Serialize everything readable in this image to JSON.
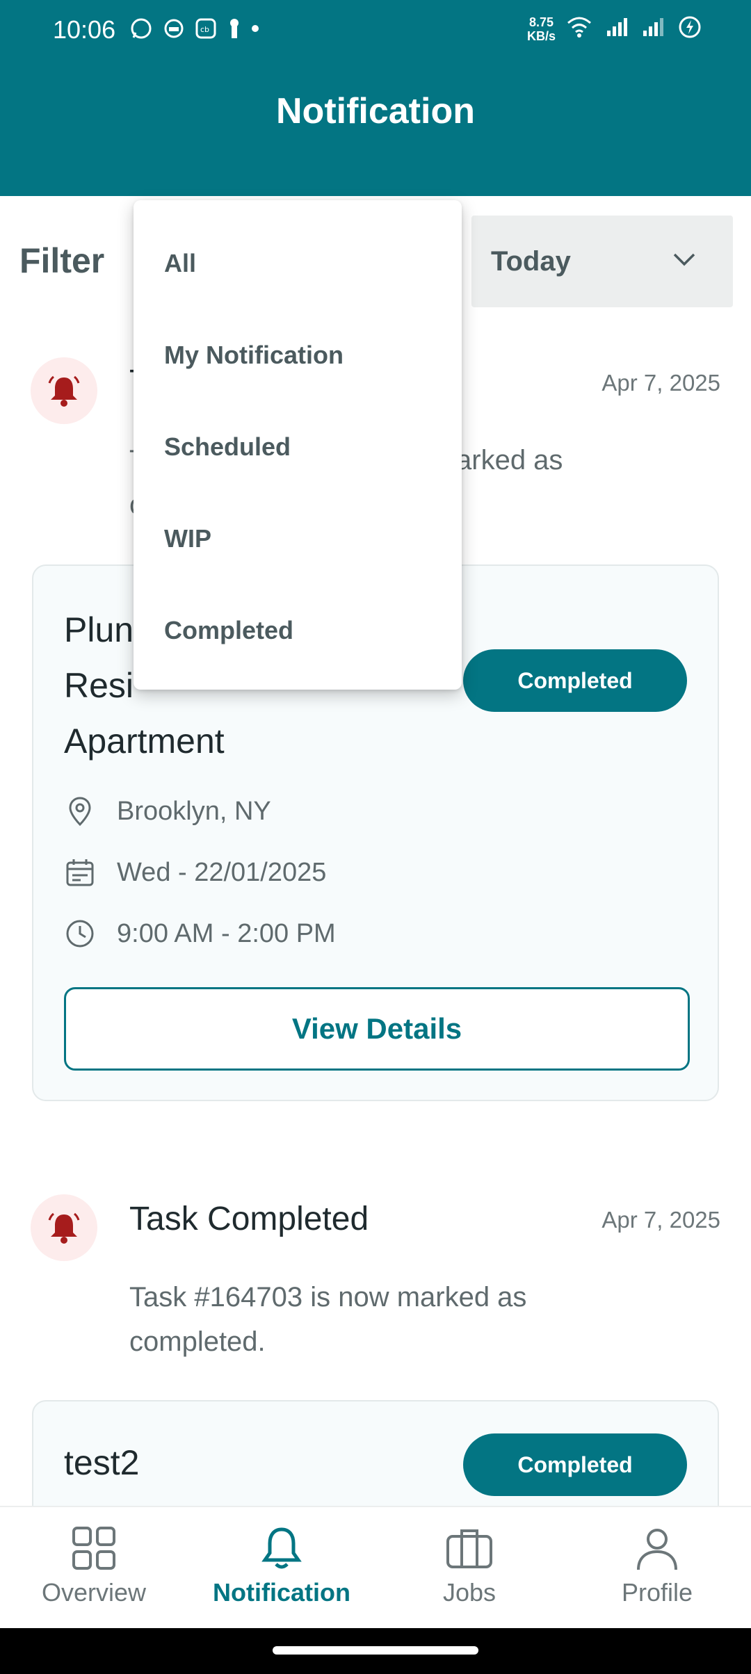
{
  "status_bar": {
    "time": "10:06",
    "net_speed_value": "8.75",
    "net_speed_unit": "KB/s"
  },
  "app_bar": {
    "title": "Notification"
  },
  "filter": {
    "label": "Filter",
    "date_range": "Today",
    "menu_items": [
      "All",
      "My Notification",
      "Scheduled",
      "WIP",
      "Completed"
    ]
  },
  "notifications": [
    {
      "title": "Task Completed",
      "date": "Apr 7, 2025",
      "message": "Task #164703 is now marked as completed.",
      "visible_title_fragment": "T",
      "visible_msg_fragment_1": "T",
      "visible_msg_fragment_2": "arked as",
      "visible_msg_fragment_3": "c",
      "card": {
        "title_line_1_fragment": "Plun",
        "title_line_2_fragment": "Resi",
        "title_line_3": "Apartment",
        "status": "Completed",
        "location": "Brooklyn, NY",
        "date": "Wed - 22/01/2025",
        "time": "9:00 AM - 2:00 PM",
        "action": "View Details"
      }
    },
    {
      "title": "Task Completed",
      "date": "Apr 7, 2025",
      "message": "Task #164703 is now marked as completed.",
      "card": {
        "title": "test2",
        "status": "Completed"
      }
    }
  ],
  "bottom_nav": [
    {
      "label": "Overview",
      "active": false
    },
    {
      "label": "Notification",
      "active": true
    },
    {
      "label": "Jobs",
      "active": false
    },
    {
      "label": "Profile",
      "active": false
    }
  ],
  "colors": {
    "primary": "#037583",
    "bell": "#a61c1c",
    "bell_bg": "#fdecec"
  }
}
